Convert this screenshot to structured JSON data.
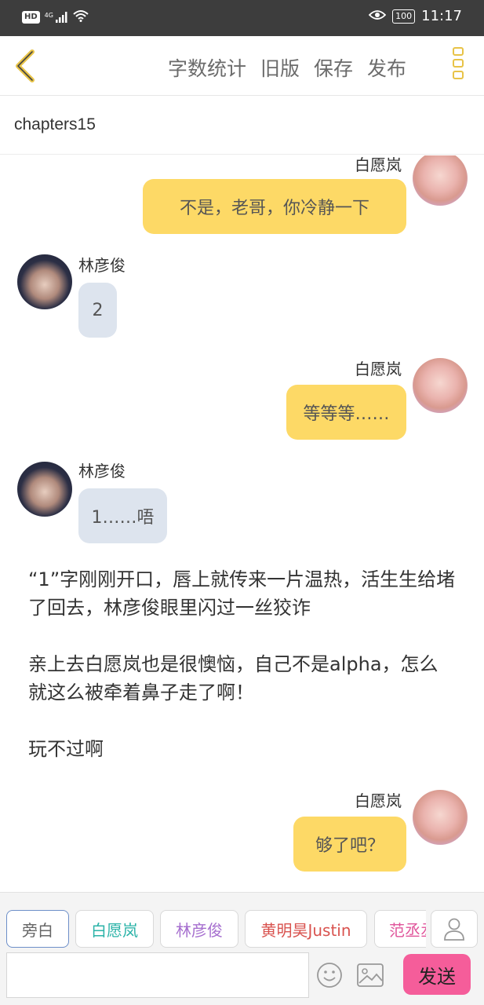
{
  "status_bar": {
    "hd": "HD",
    "signal": "4G",
    "battery": "100",
    "time": "11:17"
  },
  "header": {
    "actions": [
      "字数统计",
      "旧版",
      "保存",
      "发布"
    ],
    "accent": "#e8c347"
  },
  "chapter": {
    "title": "chapters15"
  },
  "messages": [
    {
      "speaker": "白愿岚",
      "side": "right",
      "text": "不是，老哥，你冷静一下"
    },
    {
      "speaker": "林彦俊",
      "side": "left",
      "text": "2"
    },
    {
      "speaker": "白愿岚",
      "side": "right",
      "text": "等等等……"
    },
    {
      "speaker": "林彦俊",
      "side": "left",
      "text": "1……唔"
    },
    {
      "type": "narration",
      "text": "“1”字刚刚开口，唇上就传来一片温热，活生生给堵了回去，林彦俊眼里闪过一丝狡诈"
    },
    {
      "type": "narration",
      "text": "亲上去白愿岚也是很懊恼，自己不是alpha，怎么就这么被牵着鼻子走了啊！"
    },
    {
      "type": "narration",
      "text": "玩不过啊"
    },
    {
      "speaker": "白愿岚",
      "side": "right",
      "text": "够了吧？"
    }
  ],
  "roles": [
    {
      "label": "旁白",
      "color": "#666666",
      "selected": true
    },
    {
      "label": "白愿岚",
      "color": "#2bb3a8"
    },
    {
      "label": "林彦俊",
      "color": "#a66fcf"
    },
    {
      "label": "黄明昊Justin",
      "color": "#d9534f"
    },
    {
      "label": "范丞丞",
      "color": "#e0559b"
    }
  ],
  "input": {
    "value": "",
    "placeholder": ""
  },
  "send_label": "发送",
  "colors": {
    "my_bubble": "#fdd966",
    "other_bubble": "#dde4ee",
    "send": "#f55d9a"
  }
}
